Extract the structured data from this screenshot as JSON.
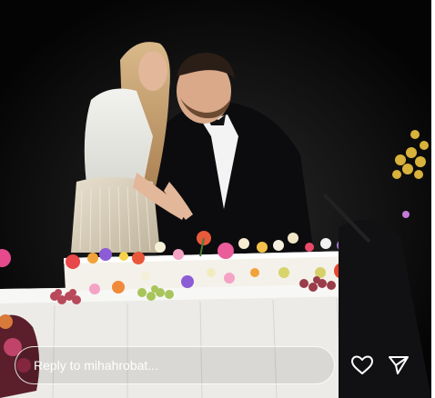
{
  "reply": {
    "placeholder": "Reply to mihahrobat..."
  },
  "icons": {
    "like": "heart-icon",
    "share": "send-icon"
  },
  "colors": {
    "background": "#050505",
    "reply_border": "#ffffff",
    "text": "#ffffff"
  }
}
